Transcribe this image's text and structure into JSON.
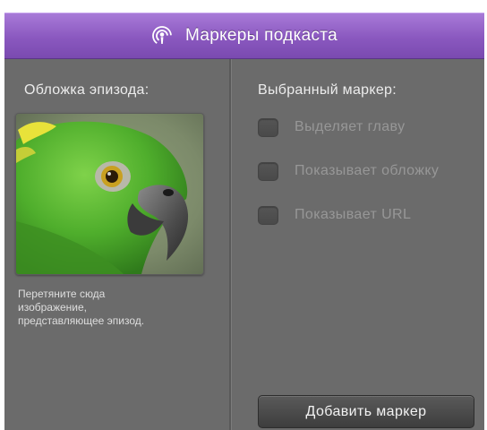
{
  "window": {
    "title": "Маркеры подкаста",
    "title_icon": "podcast-icon"
  },
  "episode_artwork": {
    "heading": "Обложка эпизода:",
    "image": "parrot-artwork",
    "hint_lines": [
      "Перетяните сюда",
      "изображение,",
      "представляющее эпизод."
    ]
  },
  "selected_marker": {
    "heading": "Выбранный маркер:",
    "options": [
      {
        "label": "Выделяет главу",
        "checked": false,
        "enabled": false
      },
      {
        "label": "Показывает обложку",
        "checked": false,
        "enabled": false
      },
      {
        "label": "Показывает URL",
        "checked": false,
        "enabled": false
      }
    ],
    "add_button_label": "Добавить маркер"
  },
  "colors": {
    "titlebar": "#8a58bf",
    "panel_background": "#6b6b6b",
    "disabled_text": "#979797"
  }
}
